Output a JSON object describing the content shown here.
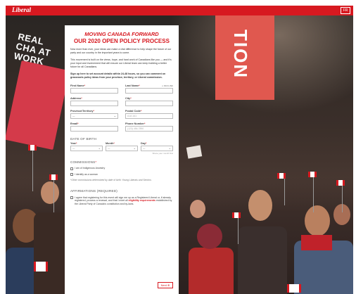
{
  "header": {
    "logo": "Liberal",
    "lang_button": "FR"
  },
  "background": {
    "sign_left_text": "REAL CHA AT WORK",
    "sign_right_text": "TION"
  },
  "form": {
    "title_line1": "MOVING CANADA FORWARD",
    "title_line2": "OUR 2020 OPEN POLICY PROCESS",
    "intro1": "Now more than ever, your ideas can make a vital difference to help shape the future of our party and our country in the important years to come.",
    "intro2": "This movement is built on the views, hope, and hard work of Canadians like you — and it's your input and involvement that will ensure our Liberal team can keep building a better future for all Canadians.",
    "intro3": "Sign up here to set account details within 24-48 hours, so you can comment on grassroots policy ideas from your province, territory, or Liberal commission.",
    "first_name_label": "First Name",
    "last_name_label": "Last Name",
    "last_name_hint": "● DECLINE",
    "address_label": "Address",
    "city_label": "City",
    "province_label": "Province/Territory",
    "province_value": "—",
    "postal_label": "Postal Code",
    "postal_placeholder": "A1A 1A1",
    "email_label": "Email",
    "phone_label": "Phone Number",
    "phone_placeholder": "(123) 456-7890",
    "dob_section": "DATE OF BIRTH",
    "year_label": "Year",
    "month_label": "Month",
    "day_label": "Day",
    "dob_value": "—",
    "dob_hint": "Share your month first",
    "commissions_section": "COMMISSIONS",
    "indigenous_label": "I am of Indigenous Ancestry",
    "woman_label": "I identify as a woman",
    "commissions_note": "*Other commissions determined by date of birth: Young Liberals and Seniors",
    "affirmations_section": "AFFIRMATIONS (REQUIRED)",
    "affirm_text_part1": "I agree that registering for this event will sign me up as a Registered Liberal or, if already registered, process a renewal, and that I meet all",
    "affirm_link": "eligibility requirements",
    "affirm_text_part2": "established by the Liberal Party of Canada's constitution and by-laws.",
    "next_button": "Next ⊕"
  }
}
